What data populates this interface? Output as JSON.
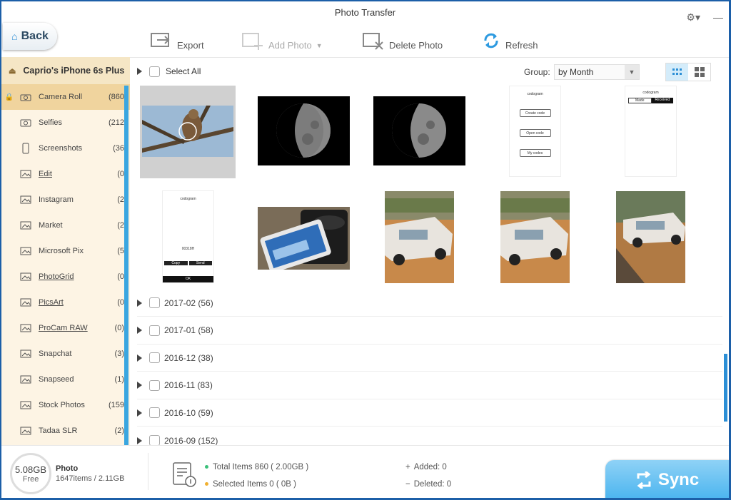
{
  "window": {
    "title": "Photo Transfer"
  },
  "toolbar": {
    "back": "Back",
    "export": "Export",
    "add_photo": "Add Photo",
    "delete_photo": "Delete Photo",
    "refresh": "Refresh"
  },
  "sidebar": {
    "device": "Caprio's iPhone 6s Plus",
    "items": [
      {
        "label": "Camera Roll",
        "count": "(860"
      },
      {
        "label": "Selfies",
        "count": "(212"
      },
      {
        "label": "Screenshots",
        "count": "(36"
      },
      {
        "label": "Edit",
        "count": "(0"
      },
      {
        "label": "Instagram",
        "count": "(2"
      },
      {
        "label": "Market",
        "count": "(2"
      },
      {
        "label": "Microsoft Pix",
        "count": "(5"
      },
      {
        "label": "PhotoGrid",
        "count": "(0"
      },
      {
        "label": "PicsArt",
        "count": "(0"
      },
      {
        "label": "ProCam RAW",
        "count": "(0)"
      },
      {
        "label": "Snapchat",
        "count": "(3)"
      },
      {
        "label": "Snapseed",
        "count": "(1)"
      },
      {
        "label": "Stock Photos",
        "count": "(159)"
      },
      {
        "label": "Tadaa SLR",
        "count": "(2)"
      }
    ]
  },
  "main": {
    "select_all": "Select All",
    "group_label": "Group:",
    "group_value": "by Month",
    "months": [
      "2017-02 (56)",
      "2017-01 (58)",
      "2016-12 (38)",
      "2016-11 (83)",
      "2016-10 (59)",
      "2016-09 (152)"
    ],
    "screens": {
      "app_name": "codogram",
      "create_code": "Create code",
      "open_code": "Open code",
      "my_codes": "My codes",
      "tab_made": "Made",
      "tab_received": "Received",
      "copy": "Copy",
      "send": "Send",
      "ok": "OK",
      "code": "00318H"
    }
  },
  "footer": {
    "free_size": "5.08GB",
    "free_label": "Free",
    "photo_title": "Photo",
    "photo_sub": "1647items / 2.11GB",
    "total": "Total Items 860 ( 2.00GB )",
    "selected": "Selected Items 0 ( 0B )",
    "added": "Added: 0",
    "deleted": "Deleted: 0",
    "sync": "Sync"
  },
  "colors": {
    "accent": "#3aa6e0",
    "sidebar_bg": "#fdf4e4",
    "active_bg": "#f0d49e"
  }
}
